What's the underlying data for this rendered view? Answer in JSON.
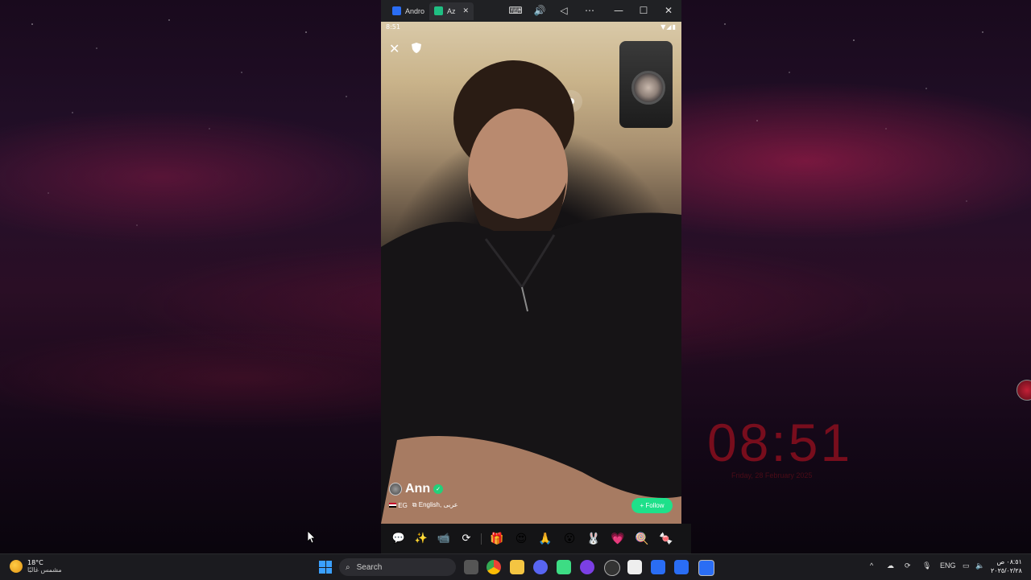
{
  "desktop": {
    "clock_time": "08:51",
    "clock_date": "Friday, 28 February 2025"
  },
  "emulator": {
    "tabs": [
      {
        "label": "Andro",
        "active": false
      },
      {
        "label": "Az",
        "active": true
      }
    ],
    "toolbar_icons": [
      "keyboard-icon",
      "volume-icon",
      "back-icon",
      "more-icon",
      "minimize-icon",
      "maximize-icon",
      "close-icon"
    ]
  },
  "phone": {
    "status_time": "8:51",
    "status_icons": "▼◢▮",
    "user": {
      "name": "Ann",
      "country": "EG",
      "languages": "English, عربى"
    },
    "follow_label": "+ Follow",
    "bottom_icons": [
      "chat-icon",
      "magic-wand-icon",
      "video-camera-icon",
      "switch-camera-icon"
    ],
    "gifts": [
      "🎁",
      "😍",
      "🙏",
      "😮",
      "🐰",
      "💗",
      "🍭",
      "🍬"
    ]
  },
  "taskbar": {
    "weather_temp": "18°C",
    "weather_desc": "مشمس غالبًا",
    "search_placeholder": "Search",
    "language": "ENG",
    "time": "٠٨:٥١ ص",
    "date": "٢٠٢٥/٠٢/٢٨"
  },
  "colors": {
    "follow_green": "#1ee08a",
    "verify_green": "#23d07a",
    "clock_red": "#8a0f1e"
  }
}
